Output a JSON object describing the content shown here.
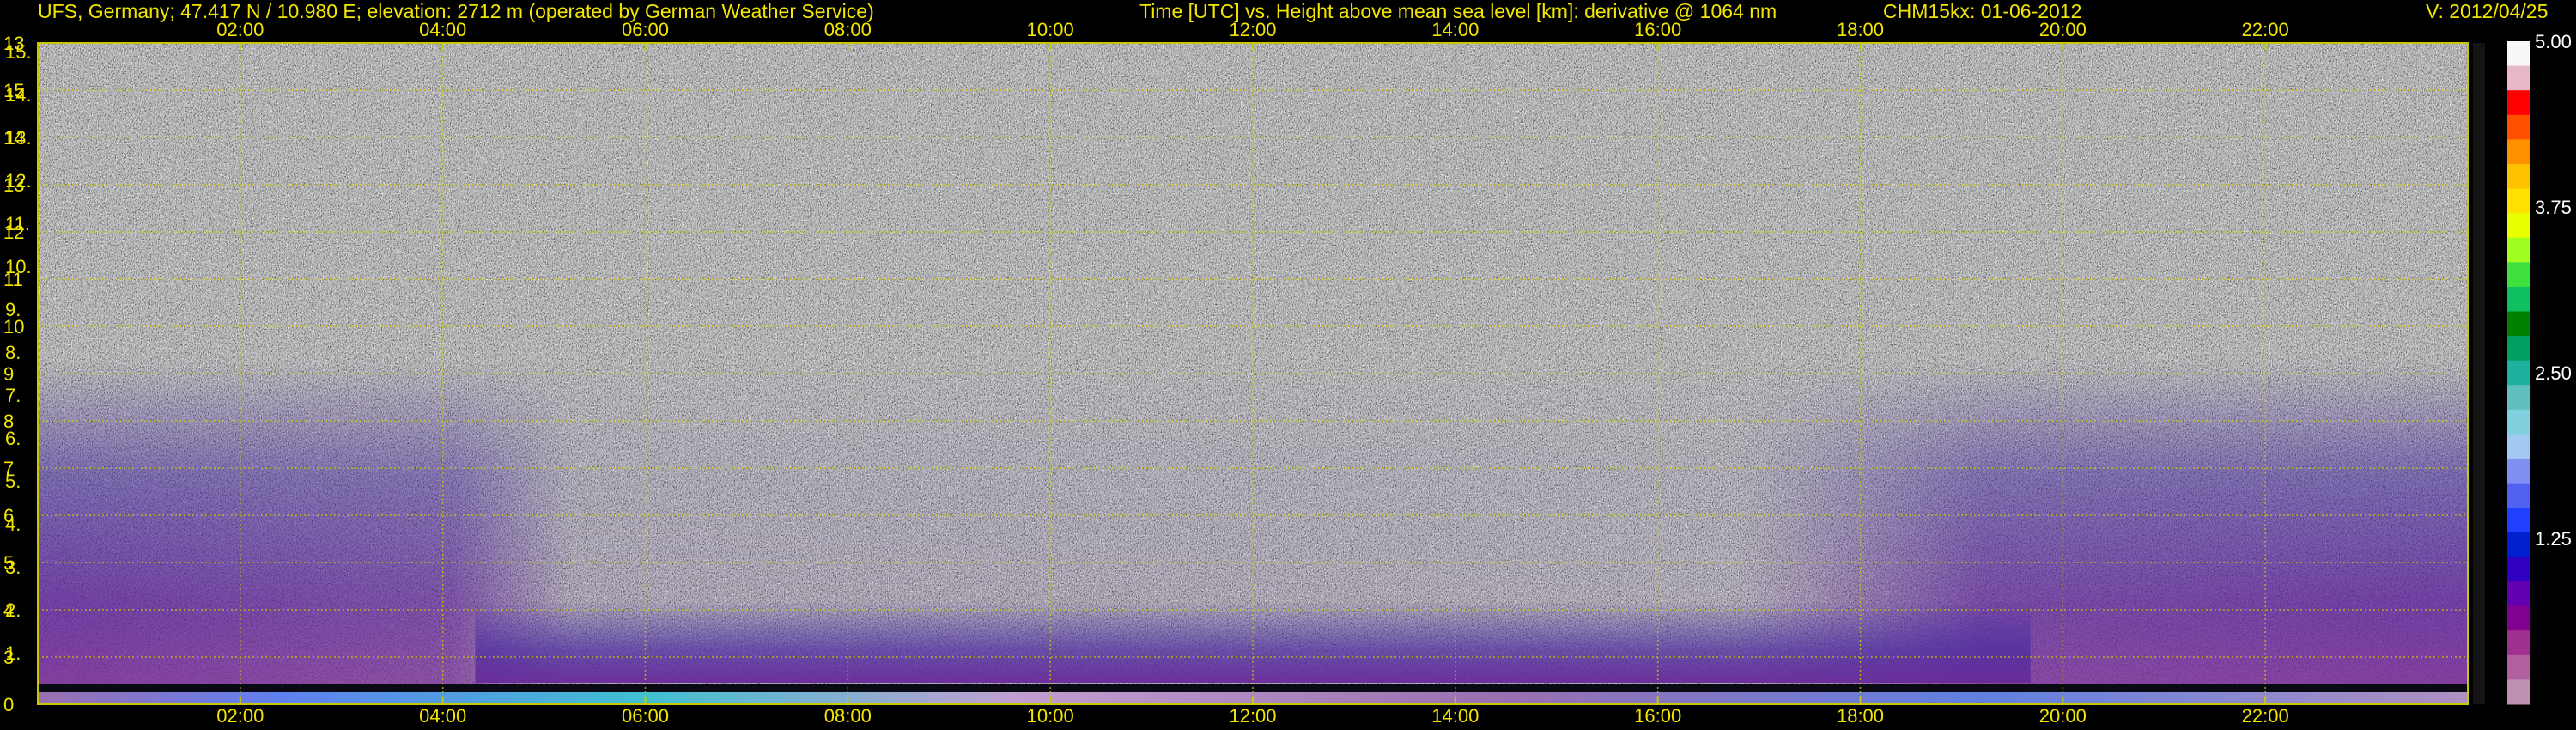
{
  "header": {
    "site": "UFS, Germany; 47.417 N / 10.980 E; elevation: 2712 m  (operated by German Weather Service)",
    "plot_title": "Time [UTC] vs. Height above mean sea level [km]: derivative @ 1064 nm",
    "instrument_date": "CHM15kx: 01-06-2012",
    "version": "V: 2012/04/25"
  },
  "colors": {
    "text": "#f2e600",
    "grid": "#c8c800",
    "background": "#000000",
    "colorbar_text": "#ffffff"
  },
  "chart_data": {
    "type": "heatmap",
    "title": "Time [UTC] vs. Height above mean sea level [km]: derivative @ 1064 nm",
    "xlabel": "Time [UTC]",
    "ylabel": "Height above mean sea level [km]",
    "x_range": [
      "00:00",
      "24:00"
    ],
    "x_ticks": [
      "02:00",
      "04:00",
      "06:00",
      "08:00",
      "10:00",
      "12:00",
      "14:00",
      "16:00",
      "18:00",
      "20:00",
      "22:00"
    ],
    "y_ticks_left_outer": [
      "0",
      "3",
      "4",
      "5",
      "6",
      "7",
      "8",
      "9",
      "10",
      "11",
      "12",
      "13",
      "14",
      "15",
      "13"
    ],
    "y_ticks_left_inner": [
      "1.",
      "2.",
      "3.",
      "4.",
      "5.",
      "6.",
      "7.",
      "8.",
      "9.",
      "10.",
      "11.",
      "12.",
      "13.",
      "14.",
      "15."
    ],
    "colorbar": {
      "min": 0,
      "max": 5.0,
      "ticks": [
        "5.00",
        "3.75",
        "2.50",
        "1.25"
      ],
      "tick_values": [
        5.0,
        3.75,
        2.5,
        1.25
      ],
      "colors": [
        "#f8f8f8",
        "#e8b8c8",
        "#ff0000",
        "#ff5000",
        "#ff9000",
        "#ffc000",
        "#ffe000",
        "#e8ff00",
        "#a0ff20",
        "#40e040",
        "#10c060",
        "#008000",
        "#00a060",
        "#20b0a0",
        "#60c0c0",
        "#80d0e0",
        "#a0c8f0",
        "#8090f0",
        "#5060f0",
        "#2040ff",
        "#0020d0",
        "#3000c0",
        "#6000b0",
        "#800090",
        "#a03090",
        "#b060a0",
        "#c090b0"
      ]
    },
    "grid": true,
    "pattern": "Strong backscatter gradients (purple/blue) in the boundary layer below ~3 km, deepest in early morning (00:00-05:00) and evening (17:30-24:00); noise dominated (grey) above and during midday; thin bright band near ground."
  }
}
